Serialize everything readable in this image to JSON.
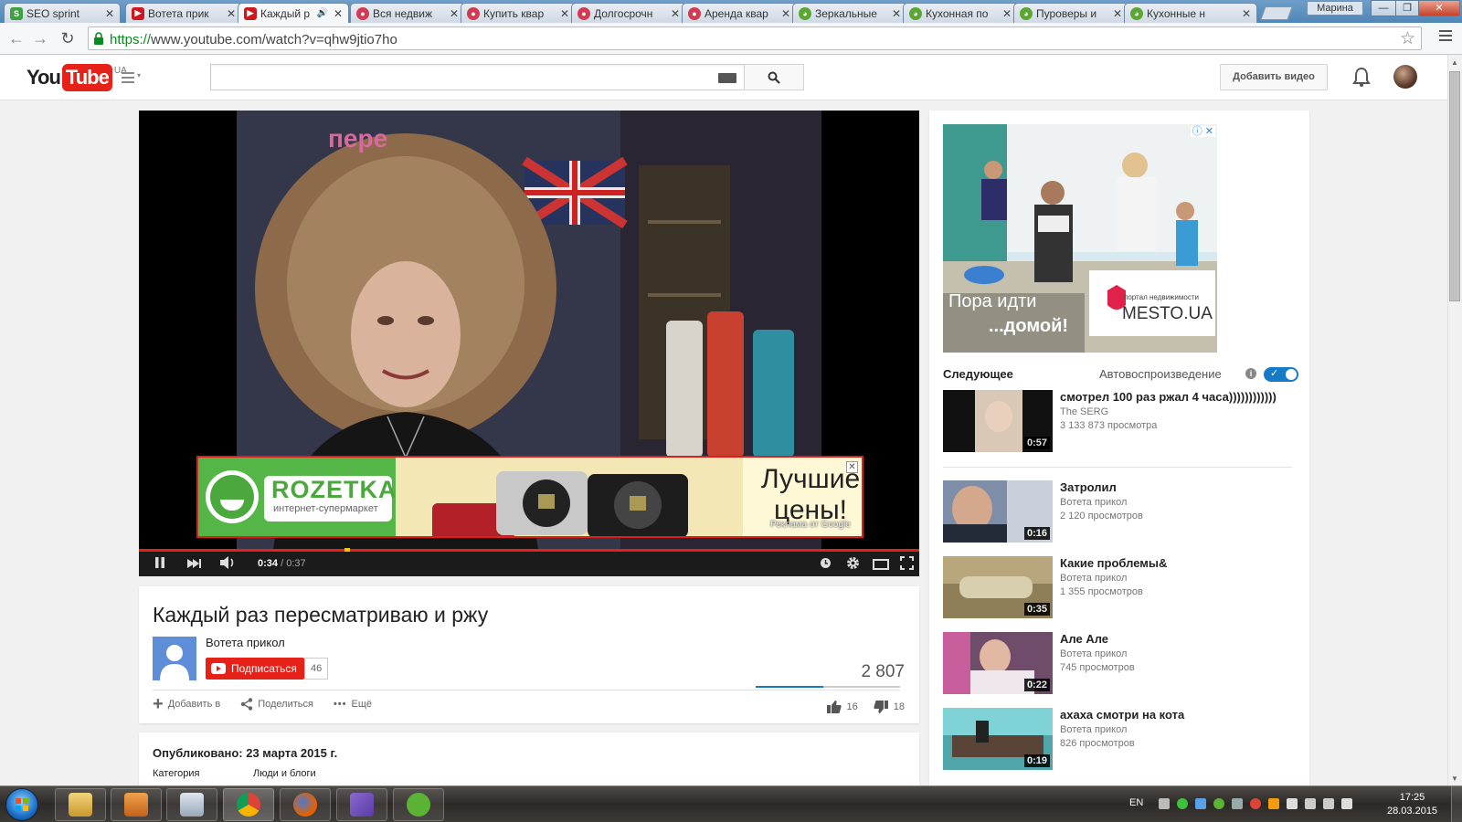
{
  "browser": {
    "tabs": [
      {
        "label": "SEO sprint",
        "fav": "#3fa13f",
        "left": 0
      },
      {
        "label": "Вотета прик",
        "fav": "#cc181e"
      },
      {
        "label": "Каждый р",
        "fav": "#cc181e",
        "active": true
      },
      {
        "label": "Вся недвиж",
        "fav": "#d23b52"
      },
      {
        "label": "Купить квар",
        "fav": "#d23b52"
      },
      {
        "label": "Долгосрочн",
        "fav": "#d23b52"
      },
      {
        "label": "Аренда квар",
        "fav": "#d23b52"
      },
      {
        "label": "Зеркальные",
        "fav": "#5aa832"
      },
      {
        "label": "Кухонная по",
        "fav": "#5aa832"
      },
      {
        "label": "Пуроверы и",
        "fav": "#5aa832"
      },
      {
        "label": "Кухонные н",
        "fav": "#5aa832"
      }
    ],
    "user": "Марина",
    "url_scheme": "https://",
    "url_host": "www.youtube.com",
    "url_path": "/watch?v=qhw9jtio7ho"
  },
  "youtube": {
    "logo_you": "You",
    "logo_tube": "Tube",
    "region": "UA",
    "add_video": "Добавить видео"
  },
  "player": {
    "current_time": "0:34",
    "duration": "/ 0:37",
    "progress_fraction": 0.26,
    "ad": {
      "brand": "ROZETKA",
      "tagline": "интернет-супермаркет",
      "slogan_line1": "Лучшие",
      "slogan_line2": "цены!",
      "ads_by": "Реклама от Google"
    },
    "watermark": "пере"
  },
  "video": {
    "title": "Каждый раз пересматриваю и ржу",
    "channel": "Вотета прикол",
    "subscribe": "Подписаться",
    "subscribers": "46",
    "views": "2 807",
    "like_ratio": 0.47,
    "add_to": "Добавить в",
    "share": "Поделиться",
    "more": "Ещё",
    "likes": "16",
    "dislikes": "18",
    "published": "Опубликовано: 23 марта 2015 г.",
    "category_label": "Категория",
    "category_value": "Люди и блоги"
  },
  "sidebar": {
    "ad_slogan1": "Пора идти",
    "ad_slogan2": "...домой!",
    "ad_portal": "портал недвижимости",
    "ad_brand": "MESTO.UA",
    "up_next": "Следующее",
    "autoplay": "Автовоспроизведение",
    "videos": [
      {
        "title": "смотрел 100 раз ржал 4 часа))))))))))))",
        "author": "The SERG",
        "views": "3 133 873 просмотра",
        "duration": "0:57",
        "thumb": "#d9c8b6"
      },
      {
        "title": "Затролил",
        "author": "Вотета прикол",
        "views": "2 120 просмотров",
        "duration": "0:16",
        "thumb": "#7f8ea8"
      },
      {
        "title": "Какие проблемы&",
        "author": "Вотета прикол",
        "views": "1 355 просмотров",
        "duration": "0:35",
        "thumb": "#b8a77c"
      },
      {
        "title": "Але Але",
        "author": "Вотета прикол",
        "views": "745 просмотров",
        "duration": "0:22",
        "thumb": "#6e4c6a"
      },
      {
        "title": "ахаха смотри на кота",
        "author": "Вотета прикол",
        "views": "826 просмотров",
        "duration": "0:19",
        "thumb": "#4fa5a8"
      }
    ]
  },
  "taskbar": {
    "lang": "EN",
    "time": "17:25",
    "date": "28.03.2015"
  }
}
